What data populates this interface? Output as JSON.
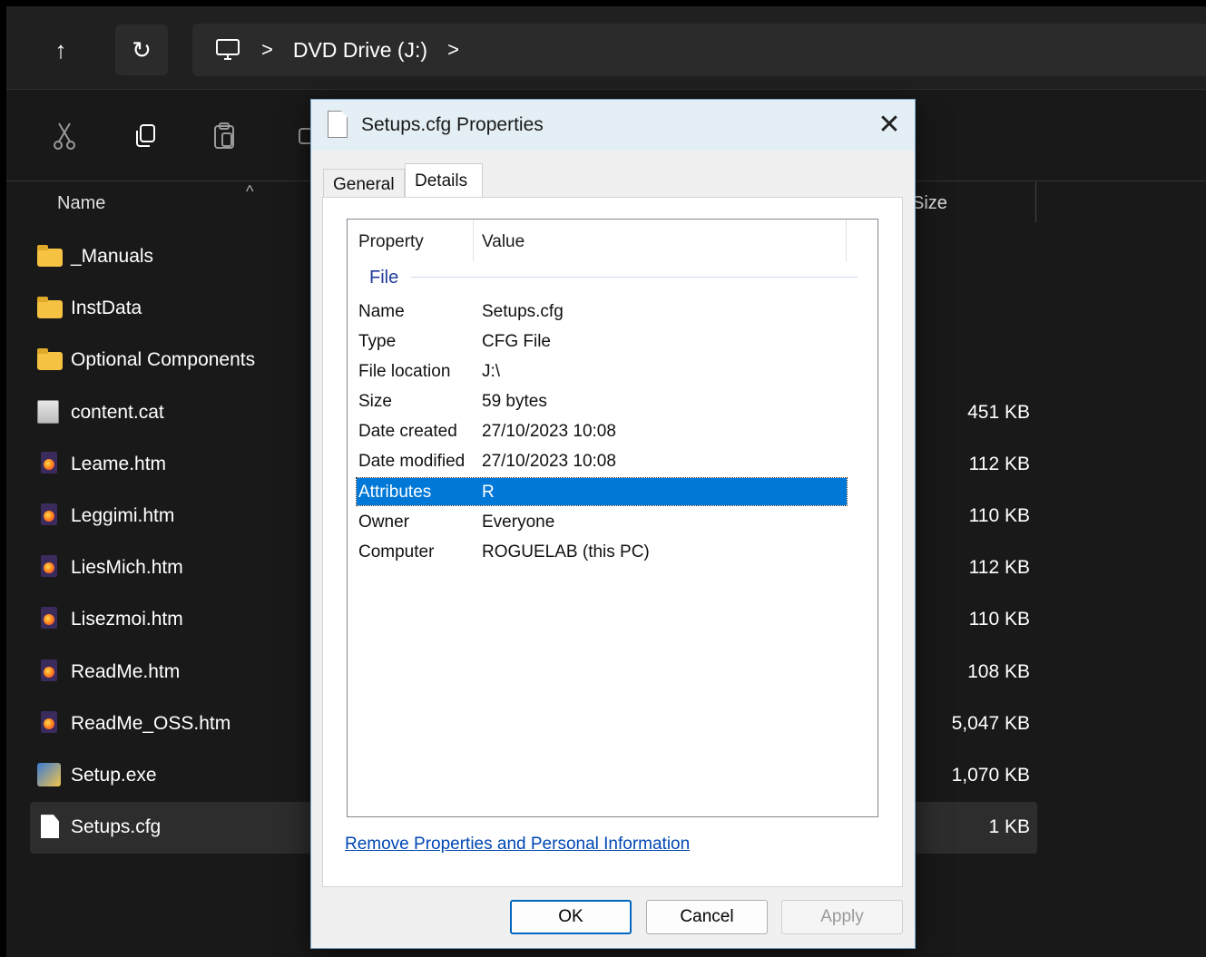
{
  "explorer": {
    "breadcrumb": {
      "location": "DVD Drive (J:)",
      "separator": ">"
    },
    "nav": {
      "up_glyph": "↑",
      "refresh_glyph": "↻"
    },
    "columns": {
      "name": "Name",
      "size": "Size"
    },
    "files": [
      {
        "name": "_Manuals",
        "size": "",
        "icon": "folder-icon"
      },
      {
        "name": "InstData",
        "size": "",
        "icon": "folder-icon"
      },
      {
        "name": "Optional Components",
        "size": "",
        "icon": "folder-icon"
      },
      {
        "name": "content.cat",
        "size": "451 KB",
        "icon": "catalog-file-icon"
      },
      {
        "name": "Leame.htm",
        "size": "112 KB",
        "icon": "firefox-htm-icon"
      },
      {
        "name": "Leggimi.htm",
        "size": "110 KB",
        "icon": "firefox-htm-icon"
      },
      {
        "name": "LiesMich.htm",
        "size": "112 KB",
        "icon": "firefox-htm-icon"
      },
      {
        "name": "Lisezmoi.htm",
        "size": "110 KB",
        "icon": "firefox-htm-icon"
      },
      {
        "name": "ReadMe.htm",
        "size": "108 KB",
        "icon": "firefox-htm-icon"
      },
      {
        "name": "ReadMe_OSS.htm",
        "size": "5,047 KB",
        "icon": "firefox-htm-icon"
      },
      {
        "name": "Setup.exe",
        "size": "1,070 KB",
        "icon": "setup-exe-icon"
      },
      {
        "name": "Setups.cfg",
        "size": "1 KB",
        "icon": "document-icon"
      }
    ]
  },
  "dialog": {
    "title": "Setups.cfg Properties",
    "close_glyph": "✕",
    "tabs": [
      "General",
      "Details"
    ],
    "active_tab": "Details",
    "list_header": {
      "property": "Property",
      "value": "Value"
    },
    "group": "File",
    "properties": [
      {
        "key": "Name",
        "value": "Setups.cfg"
      },
      {
        "key": "Type",
        "value": "CFG File"
      },
      {
        "key": "File location",
        "value": "J:\\"
      },
      {
        "key": "Size",
        "value": "59 bytes"
      },
      {
        "key": "Date created",
        "value": "27/10/2023 10:08"
      },
      {
        "key": "Date modified",
        "value": "27/10/2023 10:08"
      },
      {
        "key": "Attributes",
        "value": "R"
      },
      {
        "key": "Owner",
        "value": "Everyone"
      },
      {
        "key": "Computer",
        "value": "ROGUELAB (this PC)"
      }
    ],
    "selected_property": "Attributes",
    "remove_link": "Remove Properties and Personal Information",
    "buttons": {
      "ok": "OK",
      "cancel": "Cancel",
      "apply": "Apply"
    }
  },
  "colors": {
    "selection": "#0078d7",
    "link": "#0047b3",
    "group": "#1e3c9a",
    "explorer_bg": "#191919"
  }
}
